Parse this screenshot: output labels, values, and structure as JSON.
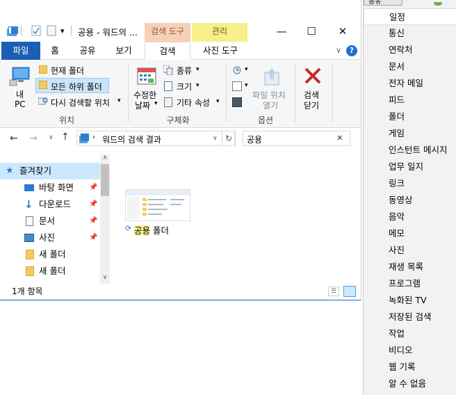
{
  "window": {
    "title": "공용 - 워드의 ...",
    "context_tab_search": "검색 도구",
    "context_tab_manage": "관리",
    "minimize_glyph": "—",
    "maximize_glyph": "☐",
    "close_glyph": "✕"
  },
  "tabs": {
    "file": "파일",
    "home": "홈",
    "share": "공유",
    "view": "보기",
    "search": "검색",
    "picture_tools": "사진 도구",
    "collapse_glyph": "∨",
    "help_glyph": "?"
  },
  "ribbon": {
    "this_pc_line1": "내",
    "this_pc_line2": "PC",
    "current_folder": "현재 폴더",
    "all_subfolders": "모든 하위 폴더",
    "search_again": "다시 검색할 위치",
    "group_location": "위치",
    "modified_line1": "수정한",
    "modified_line2": "날짜",
    "kind": "종류",
    "size": "크기",
    "other_props": "기타 속성",
    "group_refine": "구체화",
    "open_location_line1": "파일 위치",
    "open_location_line2": "열기",
    "group_options": "옵션",
    "close_search_line1": "검색",
    "close_search_line2": "닫기"
  },
  "addressbar": {
    "breadcrumb": "워드의 검색 결과",
    "search_value": "공용",
    "clear_glyph": "✕"
  },
  "nav": {
    "quick_access": "즐겨찾기",
    "items": [
      {
        "label": "바탕 화면"
      },
      {
        "label": "다운로드"
      },
      {
        "label": "문서"
      },
      {
        "label": "사진"
      },
      {
        "label": "새 폴더"
      },
      {
        "label": "새 폴더"
      }
    ]
  },
  "content": {
    "item_highlight": "공용",
    "item_rest": " 폴더"
  },
  "status": {
    "count": "1개 항목"
  },
  "menu": {
    "top_button": "공유",
    "items": [
      "일정",
      "통신",
      "연락처",
      "문서",
      "전자 메일",
      "피드",
      "폴더",
      "게임",
      "인스턴트 메시지",
      "업무 일지",
      "링크",
      "동영상",
      "음악",
      "메모",
      "사진",
      "재생 목록",
      "프로그램",
      "녹화된 TV",
      "저장된 검색",
      "작업",
      "비디오",
      "웹 기록",
      "알 수 없음"
    ],
    "selected_index": 0
  },
  "colors": {
    "accent": "#1a5fb4",
    "context_search": "#f8d0b8",
    "context_manage": "#f6f08c",
    "selection": "#cce8ff",
    "highlight": "#fff799"
  }
}
